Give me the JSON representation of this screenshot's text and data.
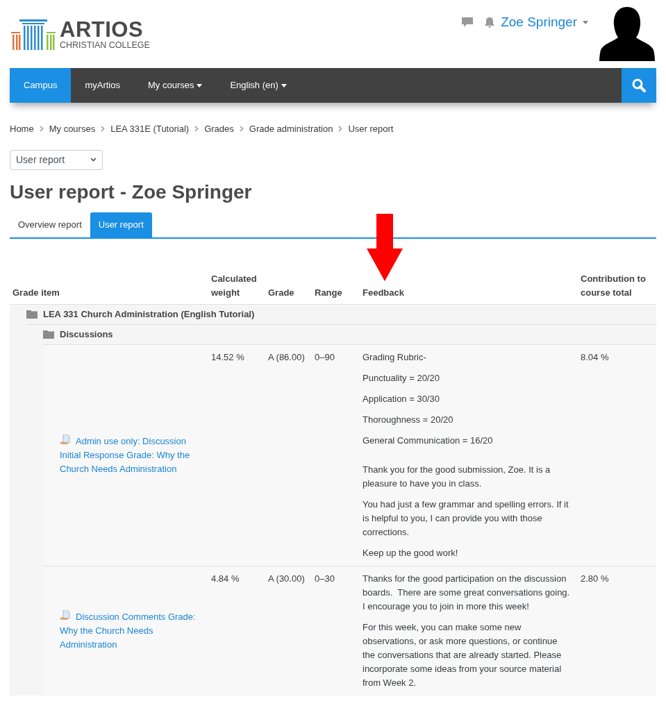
{
  "logo": {
    "name": "ARTIOS",
    "subtitle": "CHRISTIAN COLLEGE"
  },
  "user": {
    "name": "Zoe Springer"
  },
  "nav": [
    {
      "label": "Campus",
      "selected": true,
      "dropdown": false
    },
    {
      "label": "myArtios",
      "selected": false,
      "dropdown": false
    },
    {
      "label": "My courses",
      "selected": false,
      "dropdown": true
    },
    {
      "label": "English (en)",
      "selected": false,
      "dropdown": true
    }
  ],
  "breadcrumb": [
    "Home",
    "My courses",
    "LEA 331E (Tutorial)",
    "Grades",
    "Grade administration",
    "User report"
  ],
  "report_select": {
    "value": "User report"
  },
  "title": "User report - Zoe Springer",
  "tabs": [
    {
      "label": "Overview report",
      "selected": false
    },
    {
      "label": "User report",
      "selected": true
    }
  ],
  "table": {
    "columns": [
      "Grade item",
      "Calculated weight",
      "Grade",
      "Range",
      "Feedback",
      "Contribution to course total"
    ],
    "category": {
      "name": "LEA 331 Church Administration (English Tutorial)",
      "children": [
        {
          "name": "Discussions",
          "items": [
            {
              "name": "Admin use only: Discussion Initial Response Grade: Why the Church Needs Administration",
              "weight": "14.52 %",
              "grade": "A (86.00)",
              "range": "0–90",
              "contribution": "8.04 %",
              "feedback": [
                [
                  "Grading Rubric-",
                  "Punctuality = 20/20",
                  "Application = 30/30",
                  "Thoroughness = 20/20",
                  "General Communication = 16/20"
                ],
                [
                  "Thank you for the good submission, Zoe. It is a pleasure to have you in class.",
                  "You had just a few grammar and spelling errors. If it is helpful to you, I can provide you with those corrections.",
                  "Keep up the good work!"
                ]
              ]
            },
            {
              "name": "Discussion Comments Grade: Why the Church Needs Administration",
              "weight": "4.84 %",
              "grade": "A (30.00)",
              "range": "0–30",
              "contribution": "2.80 %",
              "feedback": [
                [
                  "Thanks for the good participation on the discussion boards.  There are some great conversations going. I encourage you to join in more this week!",
                  "For this week, you can make some new observations, or ask more questions, or continue the conversations that are already started. Please incorporate some ideas from your source material from Week 2."
                ]
              ]
            }
          ]
        }
      ]
    }
  }
}
